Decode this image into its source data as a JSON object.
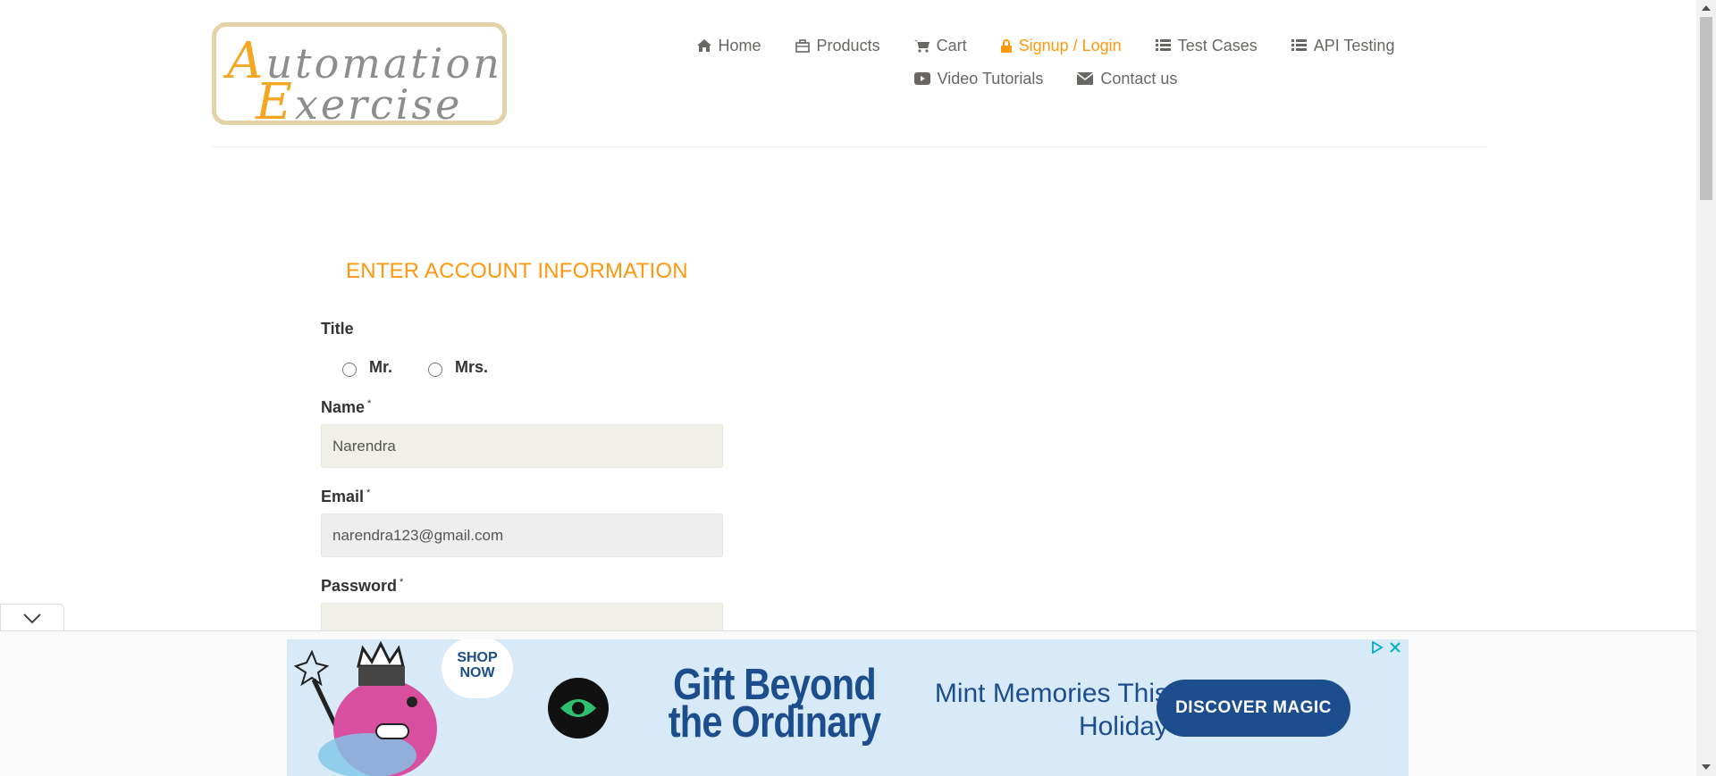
{
  "logo": {
    "line1_cap": "A",
    "line1_rest": "utomation",
    "line2_cap": "E",
    "line2_rest": "xercise"
  },
  "nav": {
    "items": [
      {
        "label": "Home",
        "icon": "home-icon"
      },
      {
        "label": "Products",
        "icon": "briefcase-icon"
      },
      {
        "label": "Cart",
        "icon": "cart-icon"
      },
      {
        "label": "Signup / Login",
        "icon": "lock-icon",
        "active": true
      },
      {
        "label": "Test Cases",
        "icon": "list-icon"
      },
      {
        "label": "API Testing",
        "icon": "list-icon"
      },
      {
        "label": "Video Tutorials",
        "icon": "youtube-icon"
      },
      {
        "label": "Contact us",
        "icon": "envelope-icon"
      }
    ],
    "active_color": "#fe980f"
  },
  "form": {
    "title": "ENTER ACCOUNT INFORMATION",
    "title_label": "Title",
    "title_options": [
      "Mr.",
      "Mrs."
    ],
    "name_label": "Name",
    "name_value": "Narendra",
    "email_label": "Email",
    "email_value": "narendra123@gmail.com",
    "password_label": "Password",
    "password_value": "",
    "required_mark": "*"
  },
  "ad": {
    "shop_now": "SHOP NOW",
    "headline": "Gift Beyond the Ordinary",
    "subline": "Mint Memories This Holiday",
    "cta": "DISCOVER MAGIC",
    "brand_color": "#1c4e8e"
  }
}
